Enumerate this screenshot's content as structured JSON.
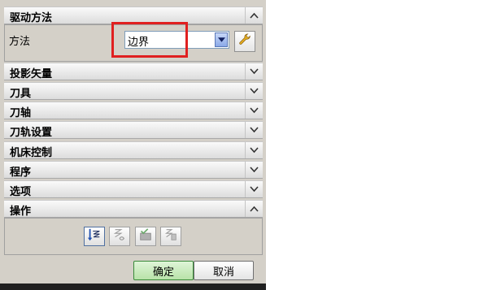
{
  "sections": [
    {
      "title": "驱动方法",
      "state": "expanded"
    },
    {
      "title": "投影矢量",
      "state": "collapsed"
    },
    {
      "title": "刀具",
      "state": "collapsed"
    },
    {
      "title": "刀轴",
      "state": "collapsed"
    },
    {
      "title": "刀轨设置",
      "state": "collapsed"
    },
    {
      "title": "机床控制",
      "state": "collapsed"
    },
    {
      "title": "程序",
      "state": "collapsed"
    },
    {
      "title": "选项",
      "state": "collapsed"
    },
    {
      "title": "操作",
      "state": "expanded"
    }
  ],
  "drive_method": {
    "label": "方法",
    "selected": "边界",
    "highlight_color": "#e02020"
  },
  "operation_icons": [
    "generate-toolpath-icon",
    "replay-icon",
    "verify-icon",
    "list-icon"
  ],
  "footer": {
    "ok_label": "确定",
    "cancel_label": "取消"
  },
  "colors": {
    "ok_accent": "#3a8a3a",
    "dropdown_accent": "#5a78b8"
  }
}
